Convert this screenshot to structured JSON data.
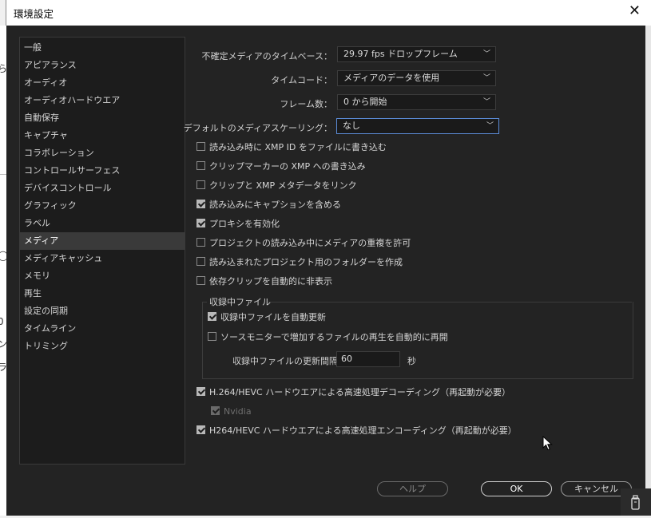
{
  "window": {
    "title": "環境設定",
    "close_glyph": "✕"
  },
  "sidebar": {
    "items": [
      "一般",
      "アピアランス",
      "オーディオ",
      "オーディオハードウエア",
      "自動保存",
      "キャプチャ",
      "コラボレーション",
      "コントロールサーフェス",
      "デバイスコントロール",
      "グラフィック",
      "ラベル",
      "メディア",
      "メディアキャッシュ",
      "メモリ",
      "再生",
      "設定の同期",
      "タイムライン",
      "トリミング"
    ],
    "selected": "メディア"
  },
  "settings": {
    "timebase_label": "不確定メディアのタイムベース：",
    "timebase_value": "29.97 fps ドロップフレーム",
    "timecode_label": "タイムコード：",
    "timecode_value": "メディアのデータを使用",
    "frame_count_label": "フレーム数：",
    "frame_count_value": "0 から開始",
    "scaling_label": "デフォルトのメディアスケーリング：",
    "scaling_value": "なし"
  },
  "checkboxes": [
    {
      "label": "読み込み時に XMP ID をファイルに書き込む",
      "checked": false
    },
    {
      "label": "クリップマーカーの XMP への書き込み",
      "checked": false
    },
    {
      "label": "クリップと XMP メタデータをリンク",
      "checked": false
    },
    {
      "label": "読み込みにキャプションを含める",
      "checked": true
    },
    {
      "label": "プロキシを有効化",
      "checked": true
    },
    {
      "label": "プロジェクトの読み込み中にメディアの重複を許可",
      "checked": false
    },
    {
      "label": "読み込まれたプロジェクト用のフォルダーを作成",
      "checked": false
    },
    {
      "label": "依存クリップを自動的に非表示",
      "checked": false
    }
  ],
  "growing_files": {
    "title": "収録中ファイル",
    "auto_refresh_label": "収録中ファイルを自動更新",
    "auto_refresh_checked": true,
    "resume_label": "ソースモニターで増加するファイルの再生を自動的に再開",
    "resume_checked": false,
    "interval_label": "収録中ファイルの更新間隔",
    "interval_value": "60",
    "interval_unit": "秒"
  },
  "hardware": {
    "decode_label": "H.264/HEVC ハードウエアによる高速処理デコーディング（再起動が必要）",
    "decode_checked": true,
    "nvidia_label": "Nvidia",
    "nvidia_checked": true,
    "encode_label": "H264/HEVC ハードウエアによる高速処理エンコーディング（再起動が必要）",
    "encode_checked": true
  },
  "buttons": {
    "help": "ヘルプ",
    "ok": "OK",
    "cancel": "キャンセル"
  },
  "background_fragments": [
    "ら",
    "◯",
    "0",
    "ン",
    "ラ"
  ],
  "colors": {
    "dialog_bg": "#232323",
    "selection": "#3a3a3a",
    "focus_border": "#5b8bd6"
  }
}
